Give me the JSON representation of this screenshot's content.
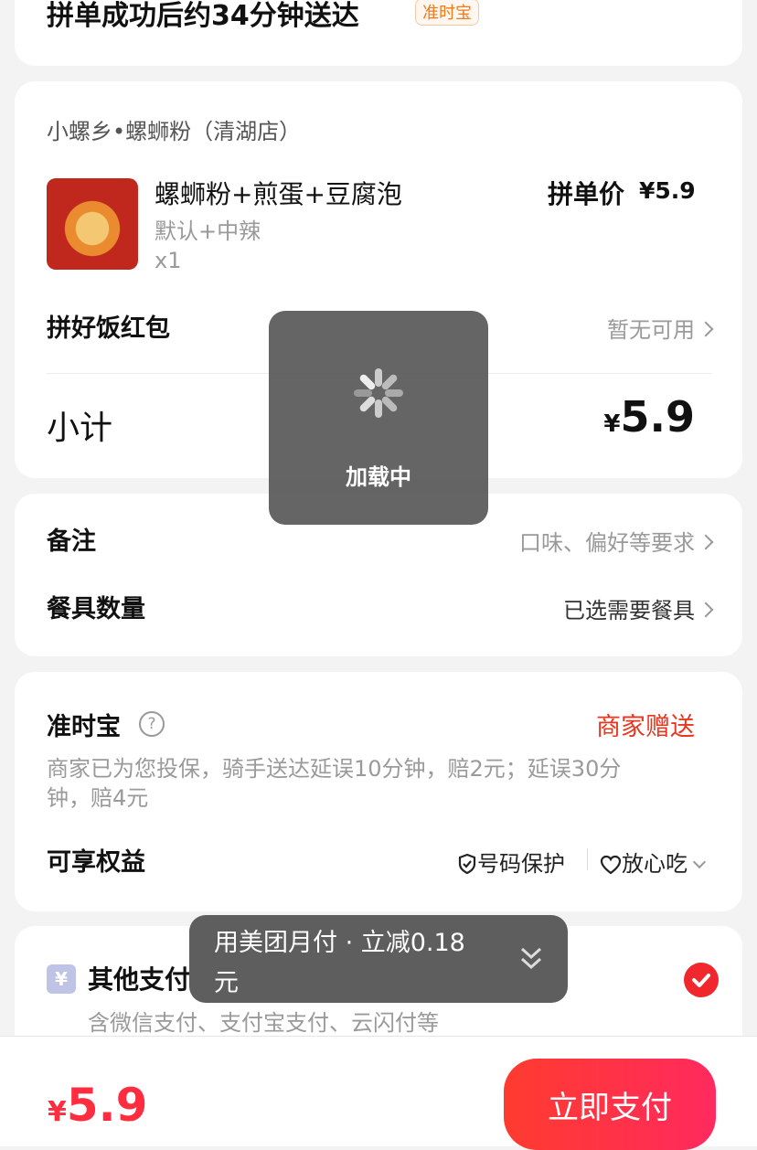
{
  "delivery": {
    "text": "拼单成功后约34分钟送达",
    "tag": "准时宝"
  },
  "store": {
    "name": "小螺乡•螺蛳粉（清湖店）",
    "item": {
      "name": "螺蛳粉+煎蛋+豆腐泡",
      "spec": "默认+中辣",
      "qty": "x1",
      "price_label": "拼单价",
      "price": "¥5.9"
    },
    "red_packet": {
      "label": "拼好饭红包",
      "value": "暂无可用"
    },
    "subtotal": {
      "label": "小计",
      "currency": "¥",
      "value": "5.9"
    }
  },
  "notes": {
    "remark_label": "备注",
    "remark_value": "口味、偏好等要求",
    "utensil_label": "餐具数量",
    "utensil_value": "已选需要餐具"
  },
  "insurance": {
    "title": "准时宝",
    "badge": "商家赠送",
    "desc_line1": "商家已为您投保，骑手送达延误10分钟，赔2元；延误30分",
    "desc_line2": "钟，赔4元",
    "rights_label": "可享权益",
    "right1": "号码保护",
    "right2": "放心吃"
  },
  "payment": {
    "title": "其他支付",
    "desc": "含微信支付、支付宝支付、云闪付等",
    "icon_glyph": "¥"
  },
  "loading": {
    "text": "加载中"
  },
  "toast": {
    "line1": "用美团月付 · 立减0.18",
    "line2": "元"
  },
  "bottom": {
    "currency": "¥",
    "amount": "5.9",
    "pay_label": "立即支付"
  },
  "colors": {
    "accent": "#ff2d3f",
    "badge_red": "#e8361f",
    "gray": "#9a9a9a"
  }
}
